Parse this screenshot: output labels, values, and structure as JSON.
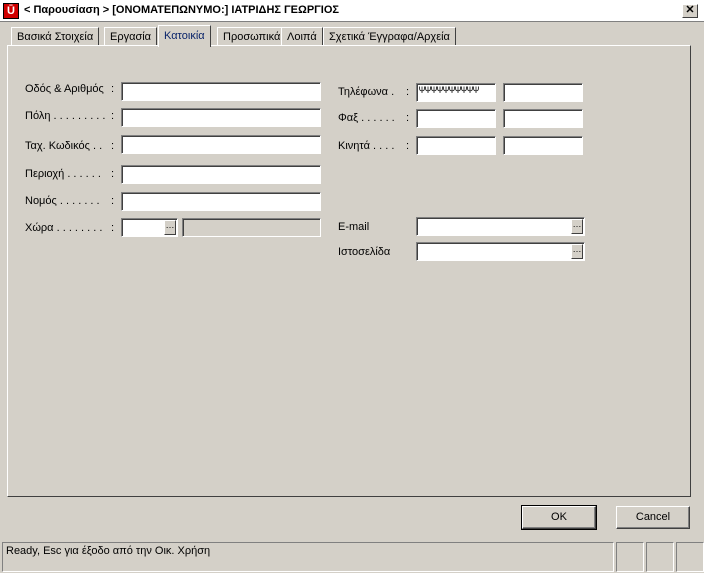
{
  "window": {
    "icon_letter": "Ū",
    "title": "< Παρουσίαση > [ΟΝΟΜΑΤΕΠΩΝΥΜΟ:] ΙΑΤΡΙΔΗΣ  ΓΕΩΡΓΙΟΣ",
    "close_glyph": "✕"
  },
  "tabs": [
    {
      "label": "Βασικά Στοιχεία"
    },
    {
      "label": "Εργασία"
    },
    {
      "label": "Κατοικία"
    },
    {
      "label": "Προσωπικά"
    },
    {
      "label": "Λοιπά"
    },
    {
      "label": "Σχετικά Έγγραφα/Αρχεία"
    }
  ],
  "active_tab": "Κατοικία",
  "address": {
    "street_label": "Οδός & Αριθμός",
    "city_label": "Πόλη . . . . . . . . .",
    "zip_label": "Ταχ. Κωδικός . .",
    "area_label": "Περιοχή . . . . . .",
    "prefecture_label": "Νομός . . . . . . .",
    "country_label": "Χώρα . . . . . . . .",
    "colon": ":",
    "street_value": "",
    "city_value": "",
    "zip_value": "",
    "area_value": "",
    "prefecture_value": "",
    "country_code_value": "",
    "country_name_value": ""
  },
  "contact": {
    "phones_label": "Τηλέφωνα .",
    "fax_label": "Φαξ . . . . . .",
    "mobiles_label": "Κινητά . . . .",
    "email_label": "E-mail",
    "website_label": "Ιστοσελίδα",
    "colon": ":",
    "phone1_value": "ΨΨΨΨΨΨΨΨΨΨ",
    "phone2_value": "",
    "fax1_value": "",
    "fax2_value": "",
    "mobile1_value": "",
    "mobile2_value": "",
    "email_value": "",
    "website_value": ""
  },
  "lookup_glyph": "…",
  "buttons": {
    "ok": "OK",
    "cancel": "Cancel"
  },
  "status": {
    "text": "Ready, Esc για έξοδο από την Οικ. Χρήση"
  }
}
